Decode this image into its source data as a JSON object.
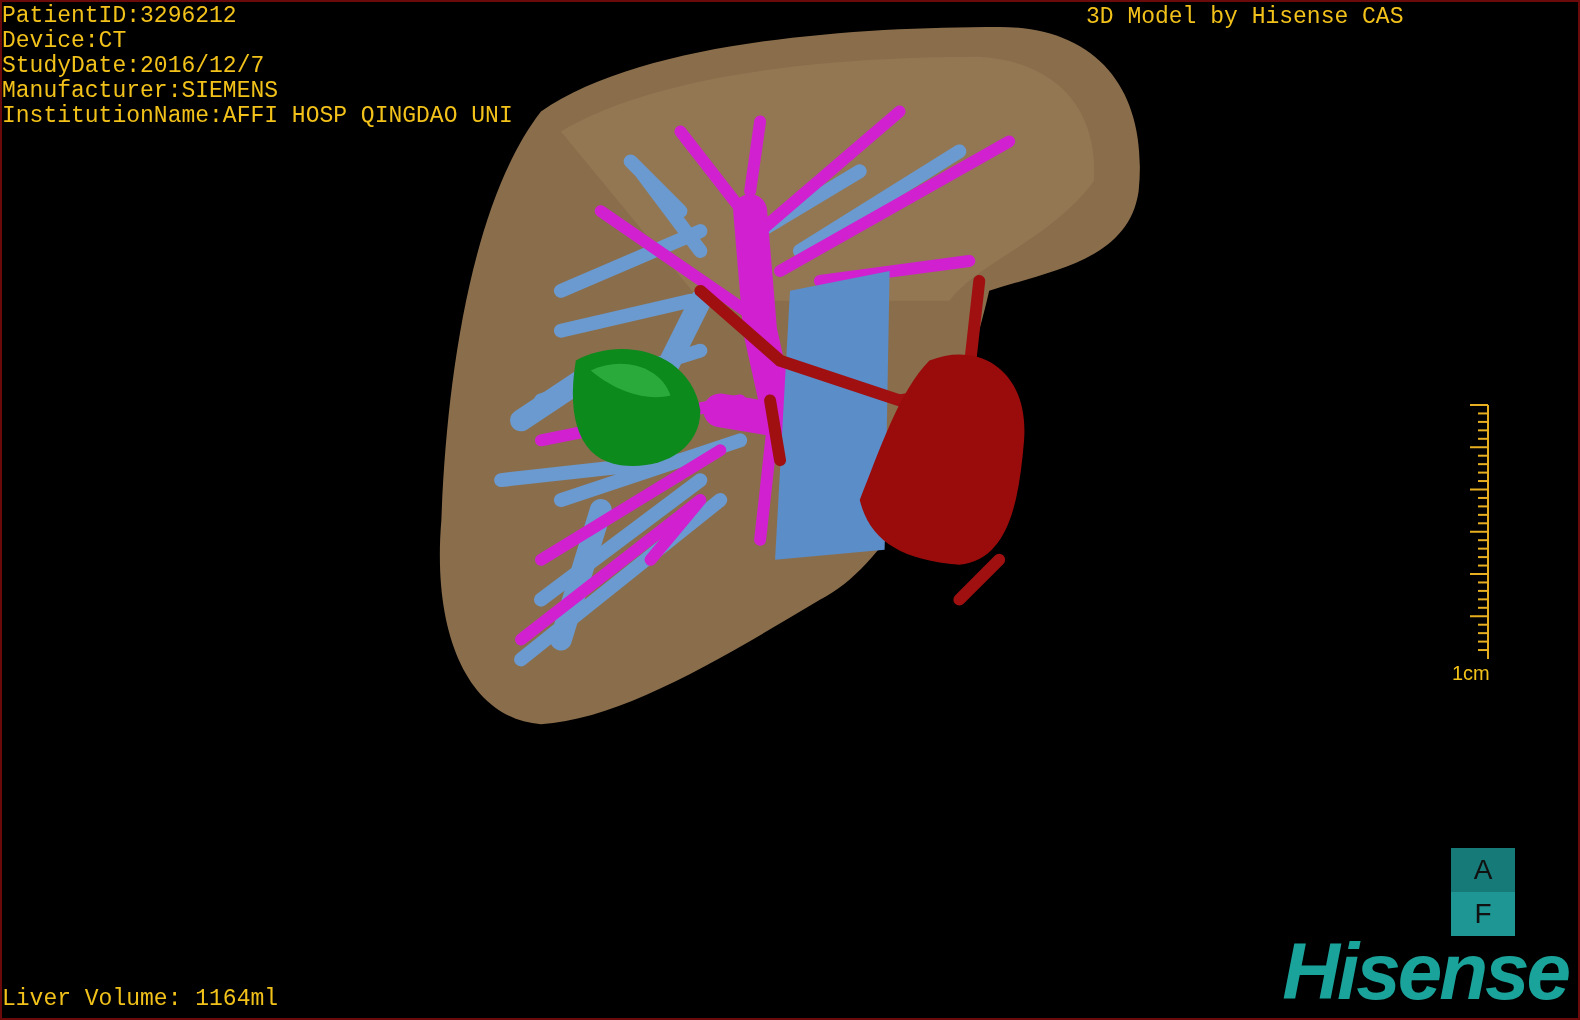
{
  "patient_info": [
    "PatientID:3296212",
    "Device:CT",
    "StudyDate:2016/12/7",
    "Manufacturer:SIEMENS",
    "InstitutionName:AFFI HOSP QINGDAO UNI"
  ],
  "model_caption": "3D Model by Hisense CAS",
  "scale_bar": {
    "label": "1cm"
  },
  "orientation_buttons": [
    "A",
    "F"
  ],
  "logo": "Hisense",
  "liver_volume": "Liver Volume: 1164ml"
}
